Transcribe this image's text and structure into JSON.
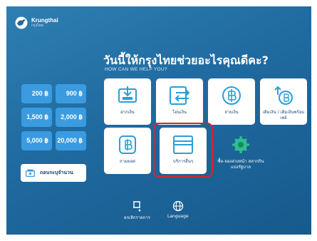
{
  "brand": {
    "name": "Krungthai",
    "sub": "กรุงไทย",
    "icon": "krungthai-bird-logo-icon"
  },
  "header": {
    "title_th": "วันนี้ให้กรุงไทยช่วยอะไรคุณดีคะ?",
    "title_en": "HOW CAN WE HELP YOU?"
  },
  "amounts": [
    "200 ฿",
    "900 ฿",
    "1,500 ฿",
    "2,000 ฿",
    "5,000 ฿",
    "20,000 ฿"
  ],
  "specify_amount": {
    "label": "ถอนระบุจำนวน",
    "icon": "cash-withdraw-icon"
  },
  "services": [
    {
      "label": "ฝากเงิน",
      "icon": "deposit-icon"
    },
    {
      "label": "โอนเงิน",
      "icon": "transfer-icon"
    },
    {
      "label": "จ่ายเงิน",
      "icon": "payment-icon"
    },
    {
      "label": "เติมเงิน / เติมเงินพร้อมเพย์",
      "icon": "topup-icon"
    },
    {
      "label": "ถามยอด",
      "icon": "balance-icon"
    },
    {
      "label": "บริการอื่นๆ",
      "icon": "other-services-icon"
    },
    {
      "label": "ซื้อ-จองล่วงหน้า สลากกินแบ่งรัฐบาล",
      "icon": "lottery-icon"
    }
  ],
  "bottom": {
    "cancel": "ยกเลิกรายการ",
    "language": "Language"
  },
  "colors": {
    "background": "#1f6aa0",
    "amount_button": "#3a9be0",
    "highlight": "#e0212c"
  }
}
